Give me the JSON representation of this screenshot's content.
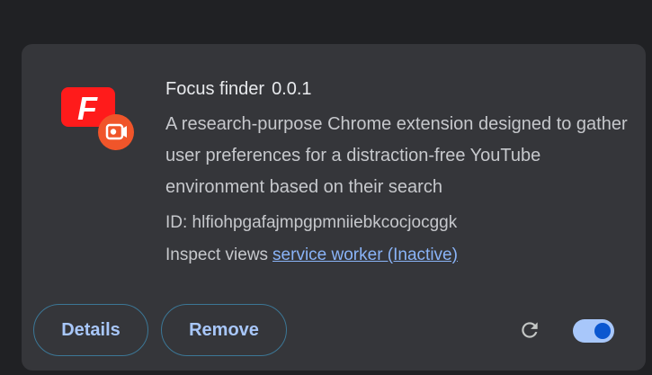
{
  "extension": {
    "name": "Focus finder",
    "version": "0.0.1",
    "description": "A research-purpose Chrome extension designed to gather user preferences for a distraction-free YouTube environment based on their search",
    "id_text": "ID: hlfiohpgafajmpgpmniiebkcocjocggk",
    "inspect_label": "Inspect views",
    "inspect_link": "service worker (Inactive)",
    "logo_letter": "F",
    "logo_icon": "focus-finder-logo-icon",
    "enabled": true
  },
  "buttons": {
    "details": "Details",
    "remove": "Remove"
  },
  "icons": {
    "reload": "reload-icon",
    "toggle": "enable-toggle"
  },
  "colors": {
    "card_bg": "#35363a",
    "page_bg": "#202124",
    "accent": "#a8c7fa",
    "link": "#8ab4f8",
    "logo_red": "#ff1b1b",
    "logo_orange": "#f0552a"
  }
}
